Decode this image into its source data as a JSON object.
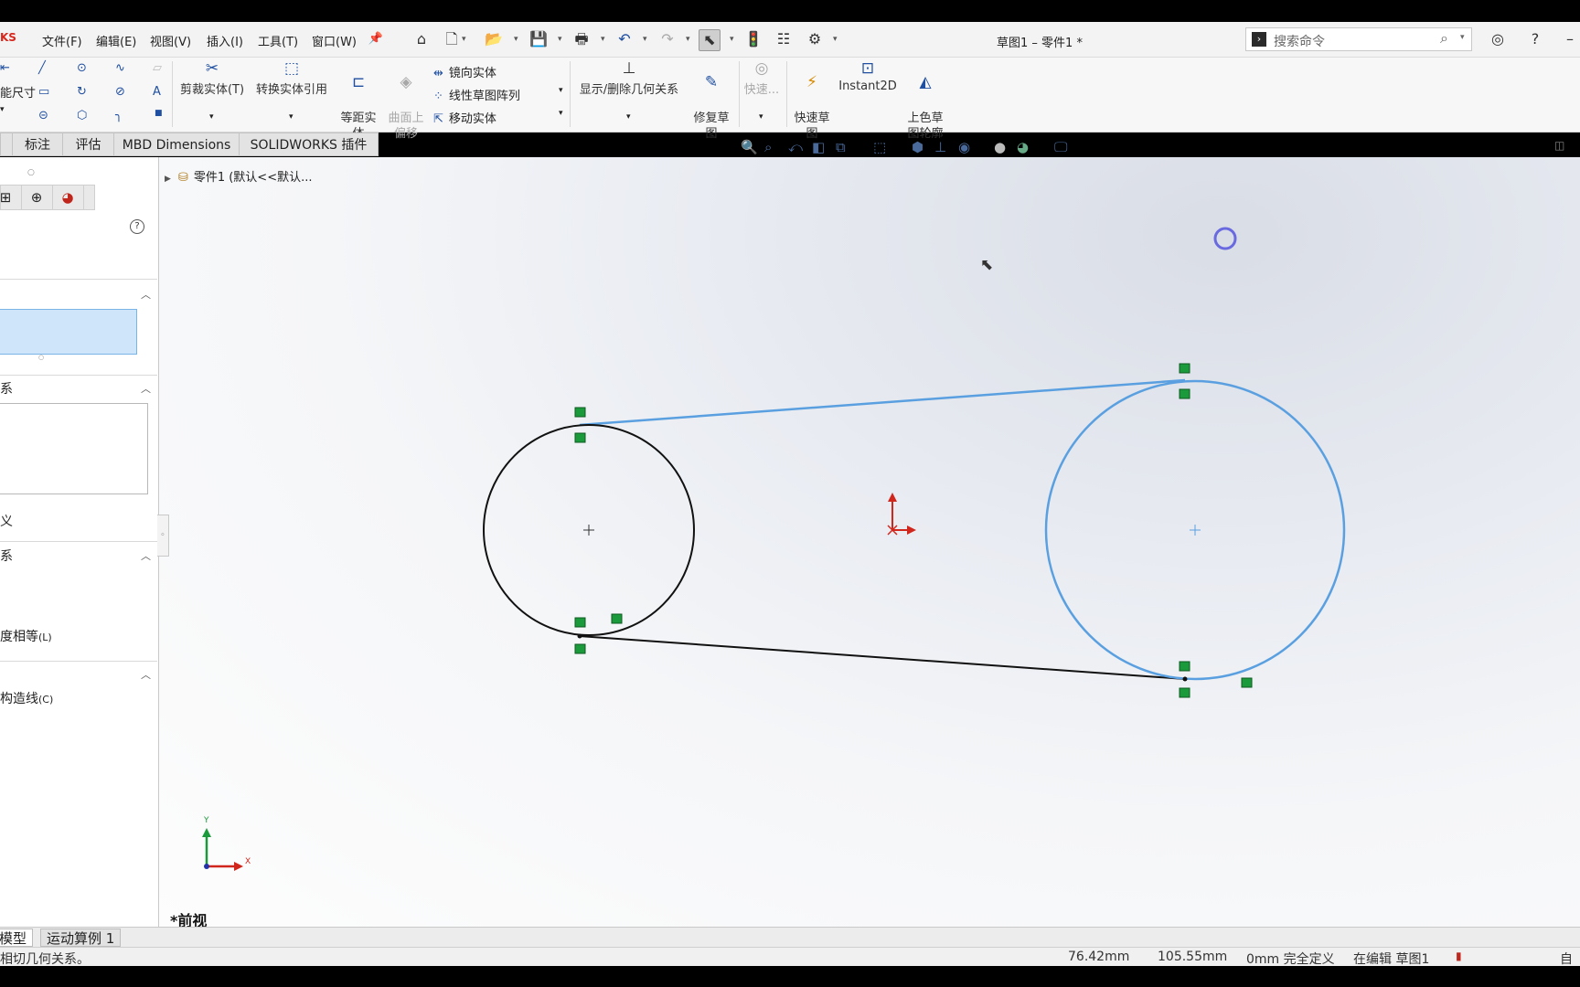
{
  "app": {
    "logo_text": "KS",
    "document_title": "草图1 – 零件1 *"
  },
  "menu": [
    "文件(F)",
    "编辑(E)",
    "视图(V)",
    "插入(I)",
    "工具(T)",
    "窗口(W)"
  ],
  "search": {
    "placeholder": "搜索命令"
  },
  "ribbon": {
    "smart_dim": "能尺寸",
    "trim": "剪裁实体(T)",
    "convert": "转换实体引用",
    "offset": "等距实\n体",
    "surface_offset": "曲面上\n偏移",
    "mirror": "镜向实体",
    "linear_pattern": "线性草图阵列",
    "move": "移动实体",
    "relations": "显示/删除几何关系",
    "repair": "修复草\n图",
    "quick_snaps": "快速...",
    "rapid_sketch": "快速草\n图",
    "instant2d": "Instant2D",
    "shaded_contours": "上色草\n图轮廓"
  },
  "tabs": [
    "标注",
    "评估",
    "MBD Dimensions",
    "SOLIDWORKS 插件"
  ],
  "tree": {
    "root_label": "零件1  (默认<<默认..."
  },
  "left_panel": {
    "section_existing_relations": "系",
    "full_define_label": "义",
    "section_add_relations": "系",
    "option_equal_curvature": "度相等",
    "option_equal_curvature_key": "(L)",
    "section_options": "",
    "option_construction": "构造线",
    "option_construction_key": "(C)"
  },
  "graphics": {
    "view_name": "*前视",
    "axis_x": "X",
    "axis_y": "Y",
    "colors": {
      "selected": "#5aa0e0",
      "sketch": "#111111",
      "relation": "#1a9a3a",
      "origin": "#d0261c"
    }
  },
  "model_tabs": [
    "模型",
    "运动算例 1"
  ],
  "status": {
    "hint": "相切几何关系。",
    "x": "76.42mm",
    "y": "105.55mm",
    "z_state": "0mm 完全定义",
    "editing": "在编辑 草图1",
    "custom": "自定"
  }
}
